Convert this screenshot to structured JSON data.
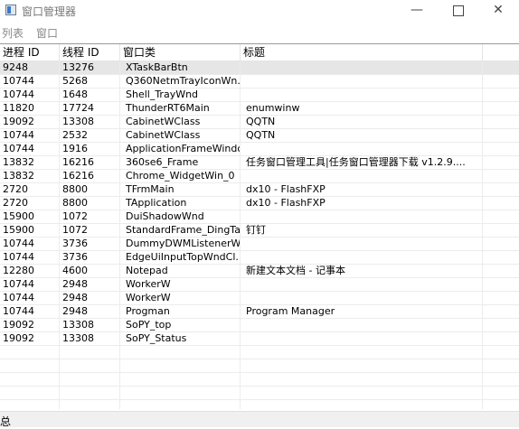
{
  "window": {
    "title": "窗口管理器"
  },
  "menu": [
    "列表",
    "窗口"
  ],
  "table": {
    "columns": [
      "进程 ID",
      "线程 ID",
      "窗口类",
      "标题"
    ],
    "rows": [
      [
        "9248",
        "13276",
        "XTaskBarBtn",
        ""
      ],
      [
        "10744",
        "5268",
        "Q360NetmTrayIconWn...",
        ""
      ],
      [
        "10744",
        "1648",
        "Shell_TrayWnd",
        ""
      ],
      [
        "11820",
        "17724",
        "ThunderRT6Main",
        "enumwinw"
      ],
      [
        "19092",
        "13308",
        "CabinetWClass",
        "QQTN"
      ],
      [
        "10744",
        "2532",
        "CabinetWClass",
        "QQTN"
      ],
      [
        "10744",
        "1916",
        "ApplicationFrameWindow",
        ""
      ],
      [
        "13832",
        "16216",
        "360se6_Frame",
        "任务窗口管理工具|任务窗口管理器下载 v1.2.9...."
      ],
      [
        "13832",
        "16216",
        "Chrome_WidgetWin_0",
        ""
      ],
      [
        "2720",
        "8800",
        "TFrmMain",
        "dx10 - FlashFXP"
      ],
      [
        "2720",
        "8800",
        "TApplication",
        "dx10 - FlashFXP"
      ],
      [
        "15900",
        "1072",
        "DuiShadowWnd",
        ""
      ],
      [
        "15900",
        "1072",
        "StandardFrame_DingTalk",
        "钉钉"
      ],
      [
        "10744",
        "3736",
        "DummyDWMListenerW...",
        ""
      ],
      [
        "10744",
        "3736",
        "EdgeUiInputTopWndCl...",
        ""
      ],
      [
        "12280",
        "4600",
        "Notepad",
        "新建文本文档 - 记事本"
      ],
      [
        "10744",
        "2948",
        "WorkerW",
        ""
      ],
      [
        "10744",
        "2948",
        "WorkerW",
        ""
      ],
      [
        "10744",
        "2948",
        "Progman",
        "Program Manager"
      ],
      [
        "19092",
        "13308",
        "SoPY_top",
        ""
      ],
      [
        "19092",
        "13308",
        "SoPY_Status",
        ""
      ]
    ],
    "selected_index": 0
  },
  "status": {
    "text": "总"
  }
}
